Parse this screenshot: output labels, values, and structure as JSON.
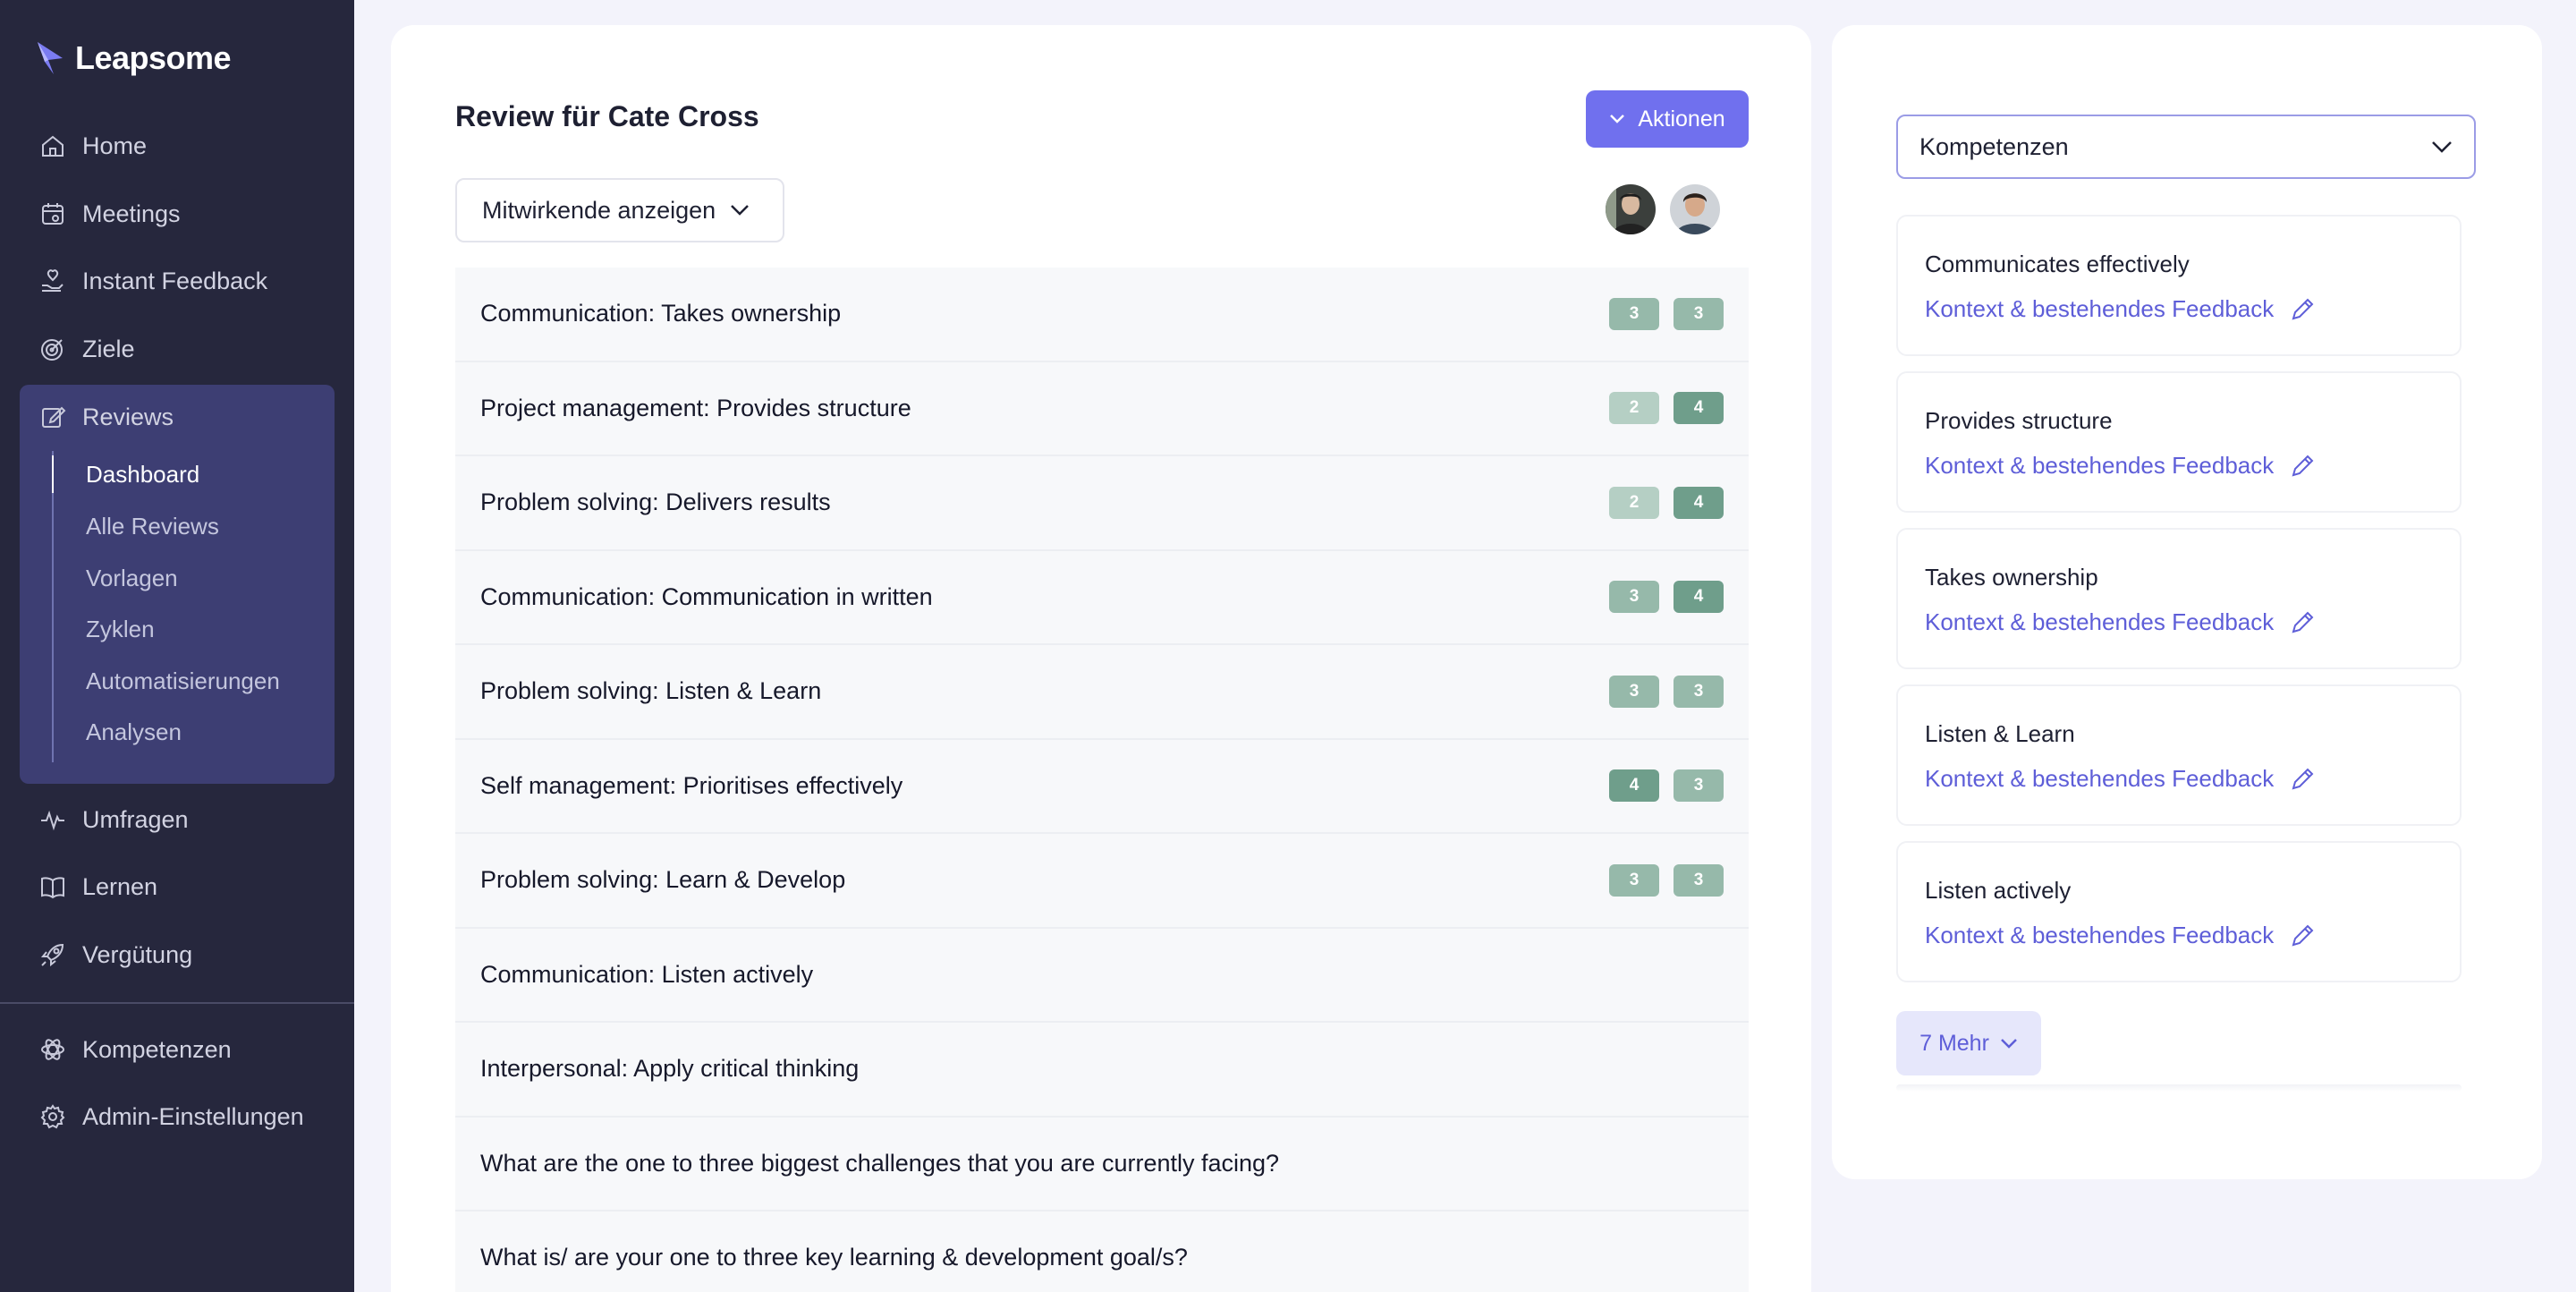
{
  "app": {
    "brand": "Leapsome",
    "accent": "#7070ee"
  },
  "sidebar": {
    "items": [
      {
        "label": "Home",
        "icon": "home-icon"
      },
      {
        "label": "Meetings",
        "icon": "calendar-icon"
      },
      {
        "label": "Instant Feedback",
        "icon": "hand-heart-icon"
      },
      {
        "label": "Ziele",
        "icon": "target-icon"
      },
      {
        "label": "Reviews",
        "icon": "edit-icon"
      },
      {
        "label": "Umfragen",
        "icon": "pulse-icon"
      },
      {
        "label": "Lernen",
        "icon": "book-icon"
      },
      {
        "label": "Vergütung",
        "icon": "rocket-icon"
      },
      {
        "label": "Kompetenzen",
        "icon": "atom-icon"
      },
      {
        "label": "Admin-Einstellungen",
        "icon": "gear-icon"
      }
    ],
    "reviews_sub": [
      "Dashboard",
      "Alle Reviews",
      "Vorlagen",
      "Zyklen",
      "Automatisierungen",
      "Analysen"
    ]
  },
  "main": {
    "title": "Review für Cate Cross",
    "actions_label": "Aktionen",
    "contributors_label": "Mitwirkende anzeigen",
    "rows": [
      {
        "label": "Communication: Takes ownership",
        "scores": [
          "3",
          "3"
        ]
      },
      {
        "label": "Project management: Provides structure",
        "scores": [
          "2",
          "4"
        ]
      },
      {
        "label": "Problem solving: Delivers results",
        "scores": [
          "2",
          "4"
        ]
      },
      {
        "label": "Communication: Communication in written",
        "scores": [
          "3",
          "4"
        ]
      },
      {
        "label": "Problem solving: Listen & Learn",
        "scores": [
          "3",
          "3"
        ]
      },
      {
        "label": "Self management: Prioritises effectively",
        "scores": [
          "4",
          "3"
        ]
      },
      {
        "label": "Problem solving: Learn & Develop",
        "scores": [
          "3",
          "3"
        ]
      },
      {
        "label": "Communication: Listen actively",
        "scores": []
      },
      {
        "label": "Interpersonal: Apply critical thinking",
        "scores": []
      },
      {
        "label": "What are the one to three biggest challenges that you are currently facing?",
        "scores": []
      },
      {
        "label": "What is/ are your one to three key learning & development goal/s?",
        "scores": []
      }
    ]
  },
  "right": {
    "select_value": "Kompetenzen",
    "competencies": [
      {
        "name": "Communicates effectively",
        "link": "Kontext & bestehendes Feedback"
      },
      {
        "name": "Provides structure",
        "link": "Kontext & bestehendes Feedback"
      },
      {
        "name": "Takes ownership",
        "link": "Kontext & bestehendes Feedback"
      },
      {
        "name": "Listen & Learn",
        "link": "Kontext & bestehendes Feedback"
      },
      {
        "name": "Listen actively",
        "link": "Kontext & bestehendes Feedback"
      }
    ],
    "more_label": "7 Mehr"
  }
}
